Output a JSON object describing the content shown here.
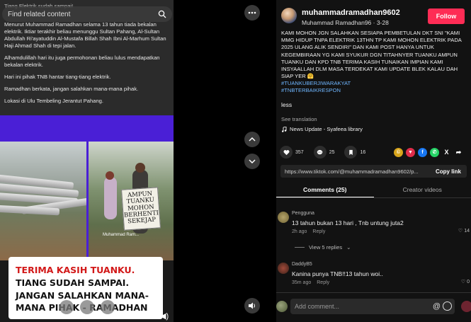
{
  "video": {
    "clipped_line": "Tiang Elektrik sudah sampai!",
    "search_placeholder": "Find related content",
    "caption_paragraphs": [
      "Menurut Muhammad Ramadhan selama 13 tahun tiada bekalan elektrik. Iktiar terakhir beliau menunggu Sultan Pahang, Al-Sultan Abdullah Ri'ayatuddin Al-Mustafa Billah Shah Ibni Al-Marhum Sultan Haji Ahmad Shah di tepi jalan.",
      "Alhamdulillah hari itu juga permohonan beliau lulus mendapatkan bekalan elektrik.",
      "Hari ini pihak TNB hantar tiang-tiang elektrik.",
      "Ramadhan berkata, jangan salahkan mana-mana pihak.",
      "Lokasi di Ulu Tembeling Jerantut Pahang."
    ],
    "sign_lines": [
      "AMPUN",
      "TUANKU",
      "MOHON",
      "BERHENTI",
      "SEKEJAP"
    ],
    "watermark": "Muhammad Ram...",
    "overlay_red": "TERIMA KASIH TUANKU.",
    "overlay_black": " TIANG SUDAH SAMPAI. JANGAN SALAHKAN MANA-MANA PIHAK - RAMADHAN"
  },
  "post": {
    "username": "muhammadramadhan9602",
    "display_name": "Muhammad Ramadhan96 · 3-28",
    "follow_label": "Follow",
    "description": "KAMI MOHON JGN SALAHKAN SESIAPA PEMBETULAN DKT SNI \"KAMI MMG HIDUP TNPA ELEKTRIK 13THN TP KAMI MOHON ELEKTRIK PADA 2025 ULANG ALIK SENDIRI\" DAN KAMI POST HANYA UNTUK KEGEMBIRAAN YG KAMI SYUKUR DGN TITAHNYER TUANKU AMPUN TUANKU DAN KPD TNB TERIMA KASIH TUNAIKAN IMPIAN KAMI INSYAALLAH DLM MASA TERDEKAT KAMI UPDATE BLEK KALAU DAH SIAP YER 🤗",
    "hashtags": [
      "#TUANKUBERJIWARAKYAT",
      "#TNBTERBAIKRESPON"
    ],
    "less_label": "less",
    "see_translation": "See translation",
    "music": "News Update - Syafeea library",
    "likes": "357",
    "comments_count": "25",
    "saves": "16",
    "link_url": "https://www.tiktok.com/@muhammadramadhan9602/p...",
    "copy_link_label": "Copy link",
    "tabs": [
      "Comments (25)",
      "Creator videos"
    ]
  },
  "comments": [
    {
      "name": "Pengguna",
      "text": "13 tahun bukan 13 hari , Tnb untung juta2",
      "time": "2h ago",
      "reply": "Reply",
      "likes": "14"
    },
    {
      "name": "DaddyB5",
      "text": "Kanina punya TNB!!13 tahun woi..",
      "time": "35m ago",
      "reply": "Reply",
      "likes": "0"
    }
  ],
  "view_replies": "View 5 replies",
  "comment_placeholder": "Add comment...",
  "comment_at": "@",
  "colors": {
    "follow": "#fe2c55",
    "hashtag": "#6fb6ff",
    "video_bg": "#4a1fd6",
    "overlay_red": "#d21818"
  },
  "icons": [
    "search-icon",
    "more-icon",
    "chevron-up-icon",
    "chevron-down-icon",
    "volume-icon",
    "heart-icon",
    "comment-icon",
    "bookmark-icon",
    "music-icon",
    "share-arrow-icon"
  ]
}
